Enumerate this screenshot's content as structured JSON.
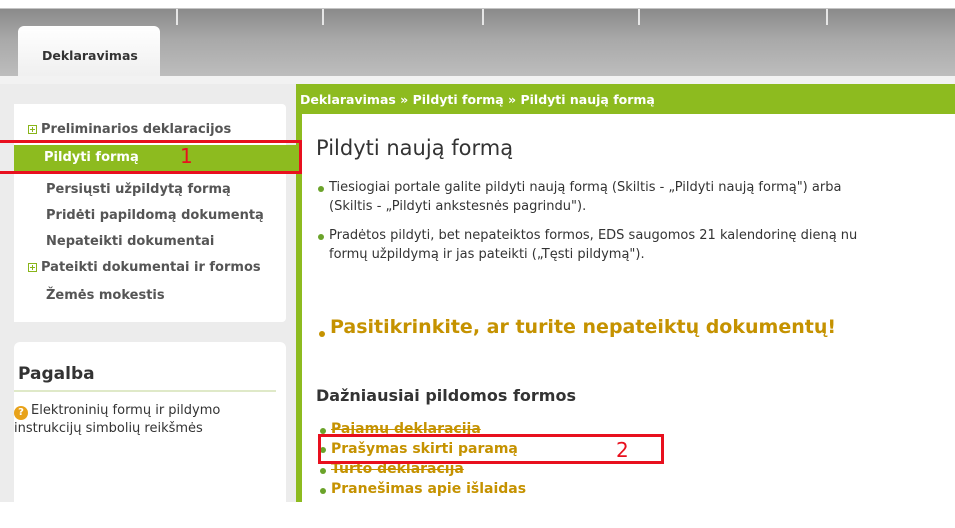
{
  "tabs": {
    "active": "Deklaravimas"
  },
  "sidebar": {
    "items": [
      {
        "label": "Preliminarios deklaracijos",
        "expandable": true
      },
      {
        "label": "Pildyti formą",
        "active": true
      },
      {
        "label": "Persiųsti užpildytą formą"
      },
      {
        "label": "Pridėti papildomą dokumentą"
      },
      {
        "label": "Nepateikti dokumentai"
      },
      {
        "label": "Pateikti dokumentai ir formos",
        "expandable": true
      },
      {
        "label": "Žemės mokestis"
      }
    ]
  },
  "help": {
    "title": "Pagalba",
    "icon": "question-icon",
    "text": "Elektroninių formų ir pildymo instrukcijų simbolių reikšmės"
  },
  "breadcrumb": "Deklaravimas » Pildyti formą » Pildyti naują formą",
  "main": {
    "title": "Pildyti naują formą",
    "bullets": [
      [
        "Tiesiogiai portale galite pildyti naują formą (Skiltis - „Pildyti naują formą\") arba",
        "(Skiltis - „Pildyti ankstesnės pagrindu\")."
      ],
      [
        "Pradėtos pildyti, bet nepateiktos formos, EDS saugomos 21 kalendorinę dieną nu",
        "formų užpildymą ir jas pateikti („Tęsti pildymą\")."
      ]
    ],
    "check_link": "Pasitikrinkite, ar turite nepateiktų dokumentų!",
    "frequent_title": "Dažniausiai pildomos formos",
    "frequent_forms": [
      "Pajamų deklaracija",
      "Prašymas skirti paramą",
      "Turto deklaracija",
      "Pranešimas apie išlaidas"
    ]
  },
  "annotations": {
    "label1": "1",
    "label2": "2",
    "color": "#e8101e"
  },
  "colors": {
    "accent_green": "#8dbb1f",
    "link_gold": "#c59200"
  }
}
